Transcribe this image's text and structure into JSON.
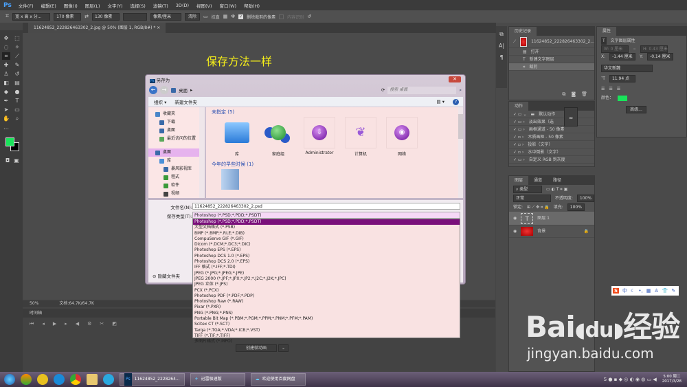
{
  "app": {
    "logo": "Ps",
    "menu": [
      "文件(F)",
      "编辑(E)",
      "图像(I)",
      "图层(L)",
      "文字(Y)",
      "选择(S)",
      "滤镜(T)",
      "3D(D)",
      "视图(V)",
      "窗口(W)",
      "帮助(H)"
    ]
  },
  "options": {
    "ratio": "宽 x 高 x 分...",
    "width": "170 像素",
    "height": "130 像素",
    "resolution": "",
    "unit": "像素/厘米",
    "clear": "清除",
    "straighten": "拉直",
    "delete_cropped": "删除裁剪的像素",
    "content_aware": "内容识别"
  },
  "doc_tab": {
    "title": "11624852_222826463302_2.jpg @ 50% (图层 1, RGB/8#) *",
    "close": "×"
  },
  "canvas": {
    "overlay_text": "保存方法一样"
  },
  "status": {
    "zoom": "50%",
    "doc": "文档:64.7K/64.7K"
  },
  "timeline": {
    "title": "时间轴",
    "create_button": "创建帧动画"
  },
  "dialog": {
    "title": "另存为",
    "breadcrumb": "桌面",
    "search_placeholder": "搜索 桌面",
    "organize": "组织 ▾",
    "new_folder": "新建文件夹",
    "nav": [
      {
        "label": "收藏夹",
        "color": "#4a86c8"
      },
      {
        "label": "下载",
        "color": "#3a6aa8"
      },
      {
        "label": "桌面",
        "color": "#3a6aa8"
      },
      {
        "label": "最近访问的位置",
        "color": "#5aa85a"
      },
      {
        "label": "桌面",
        "color": "#3a6aa8",
        "selected": true
      },
      {
        "label": "库",
        "color": "#4a90d8"
      },
      {
        "label": "暴风影视库",
        "color": "#3a6aa8"
      },
      {
        "label": "程式",
        "color": "#3a9a3a"
      },
      {
        "label": "软件",
        "color": "#3a9a3a"
      },
      {
        "label": "视频",
        "color": "#444"
      }
    ],
    "group1": "未指定 (5)",
    "items": [
      {
        "label": "库",
        "icon": "folder-stack-icon"
      },
      {
        "label": "家庭组",
        "icon": "homegroup-icon"
      },
      {
        "label": "Administrator",
        "icon": "user-icon"
      },
      {
        "label": "计算机",
        "icon": "computer-icon"
      },
      {
        "label": "网络",
        "icon": "network-icon"
      }
    ],
    "group2": "今年的早些时候 (1)",
    "filename_label": "文件名(N):",
    "filename": "11624852_222826463302_2.psd",
    "type_label": "保存类型(T):",
    "type": "Photoshop (*.PSD;*.PDD;*.PSDT)",
    "hide_folders": "隐藏文件夹",
    "type_options": [
      "Photoshop (*.PSD;*.PDD;*.PSDT)",
      "大型文档格式 (*.PSB)",
      "BMP (*.BMP;*.RLE;*.DIB)",
      "CompuServe GIF (*.GIF)",
      "Dicom (*.DCM;*.DC3;*.DIC)",
      "Photoshop EPS (*.EPS)",
      "Photoshop DCS 1.0 (*.EPS)",
      "Photoshop DCS 2.0 (*.EPS)",
      "IFF 格式 (*.IFF;*.TDI)",
      "JPEG (*.JPG;*.JPEG;*.JPE)",
      "JPEG 2000 (*.JPF;*.JPX;*.JP2;*.J2C;*.J2K;*.JPC)",
      "JPEG 立体 (*.JPS)",
      "PCX (*.PCX)",
      "Photoshop PDF (*.PDF;*.PDP)",
      "Photoshop Raw (*.RAW)",
      "Pixar (*.PXR)",
      "PNG (*.PNG;*.PNS)",
      "Portable Bit Map (*.PBM;*.PGM;*.PPM;*.PNM;*.PFM;*.PAM)",
      "Scitex CT (*.SCT)",
      "Targa (*.TGA;*.VDA;*.ICB;*.VST)",
      "TIFF (*.TIF;*.TIFF)",
      "多图片格式 (*.MPO)"
    ]
  },
  "history": {
    "title": "历史记录",
    "snapshot": "11624852_222826463302_2...",
    "steps": [
      "打开",
      "新建文字图层",
      "裁剪"
    ]
  },
  "actions": {
    "title": "动作",
    "items": [
      "默认动作",
      "淡出效果（选",
      "画框通道 - 50 像素",
      "木质画框 - 50 像素",
      "投影（文字）",
      "水中倒影（文字）",
      "自定义 RGB 到灰度"
    ]
  },
  "properties": {
    "title": "属性",
    "subtitle": "文字图层属性",
    "w": "W: 0 厘米",
    "h": "H: 0.43 厘米",
    "x": "-1.44 厘米",
    "y": "-0.14 厘米",
    "x_label": "X:",
    "y_label": "Y:",
    "font": "华文新魏",
    "size": "11.94 点",
    "color_label": "颜色：",
    "color": "#19e35a",
    "advanced": "高级..."
  },
  "layers": {
    "tabs": [
      "图层",
      "通道",
      "路径"
    ],
    "filter": "类型",
    "blend": "正常",
    "opacity_label": "不透明度:",
    "opacity": "100%",
    "lock_label": "锁定:",
    "fill_label": "填充:",
    "fill": "100%",
    "items": [
      {
        "name": "图层 1",
        "type": "text"
      },
      {
        "name": "背景",
        "type": "image"
      }
    ]
  },
  "ime": {
    "mode": "中"
  },
  "watermark": {
    "brand": "Bai du 经验",
    "url": "jingyan.baidu.com"
  },
  "taskbar": {
    "windows": [
      "11624852_2228264...",
      "迅雷极速版",
      "欢迎使用百度网盘"
    ],
    "time": "5:00 周二",
    "date": "2017/3/28"
  }
}
